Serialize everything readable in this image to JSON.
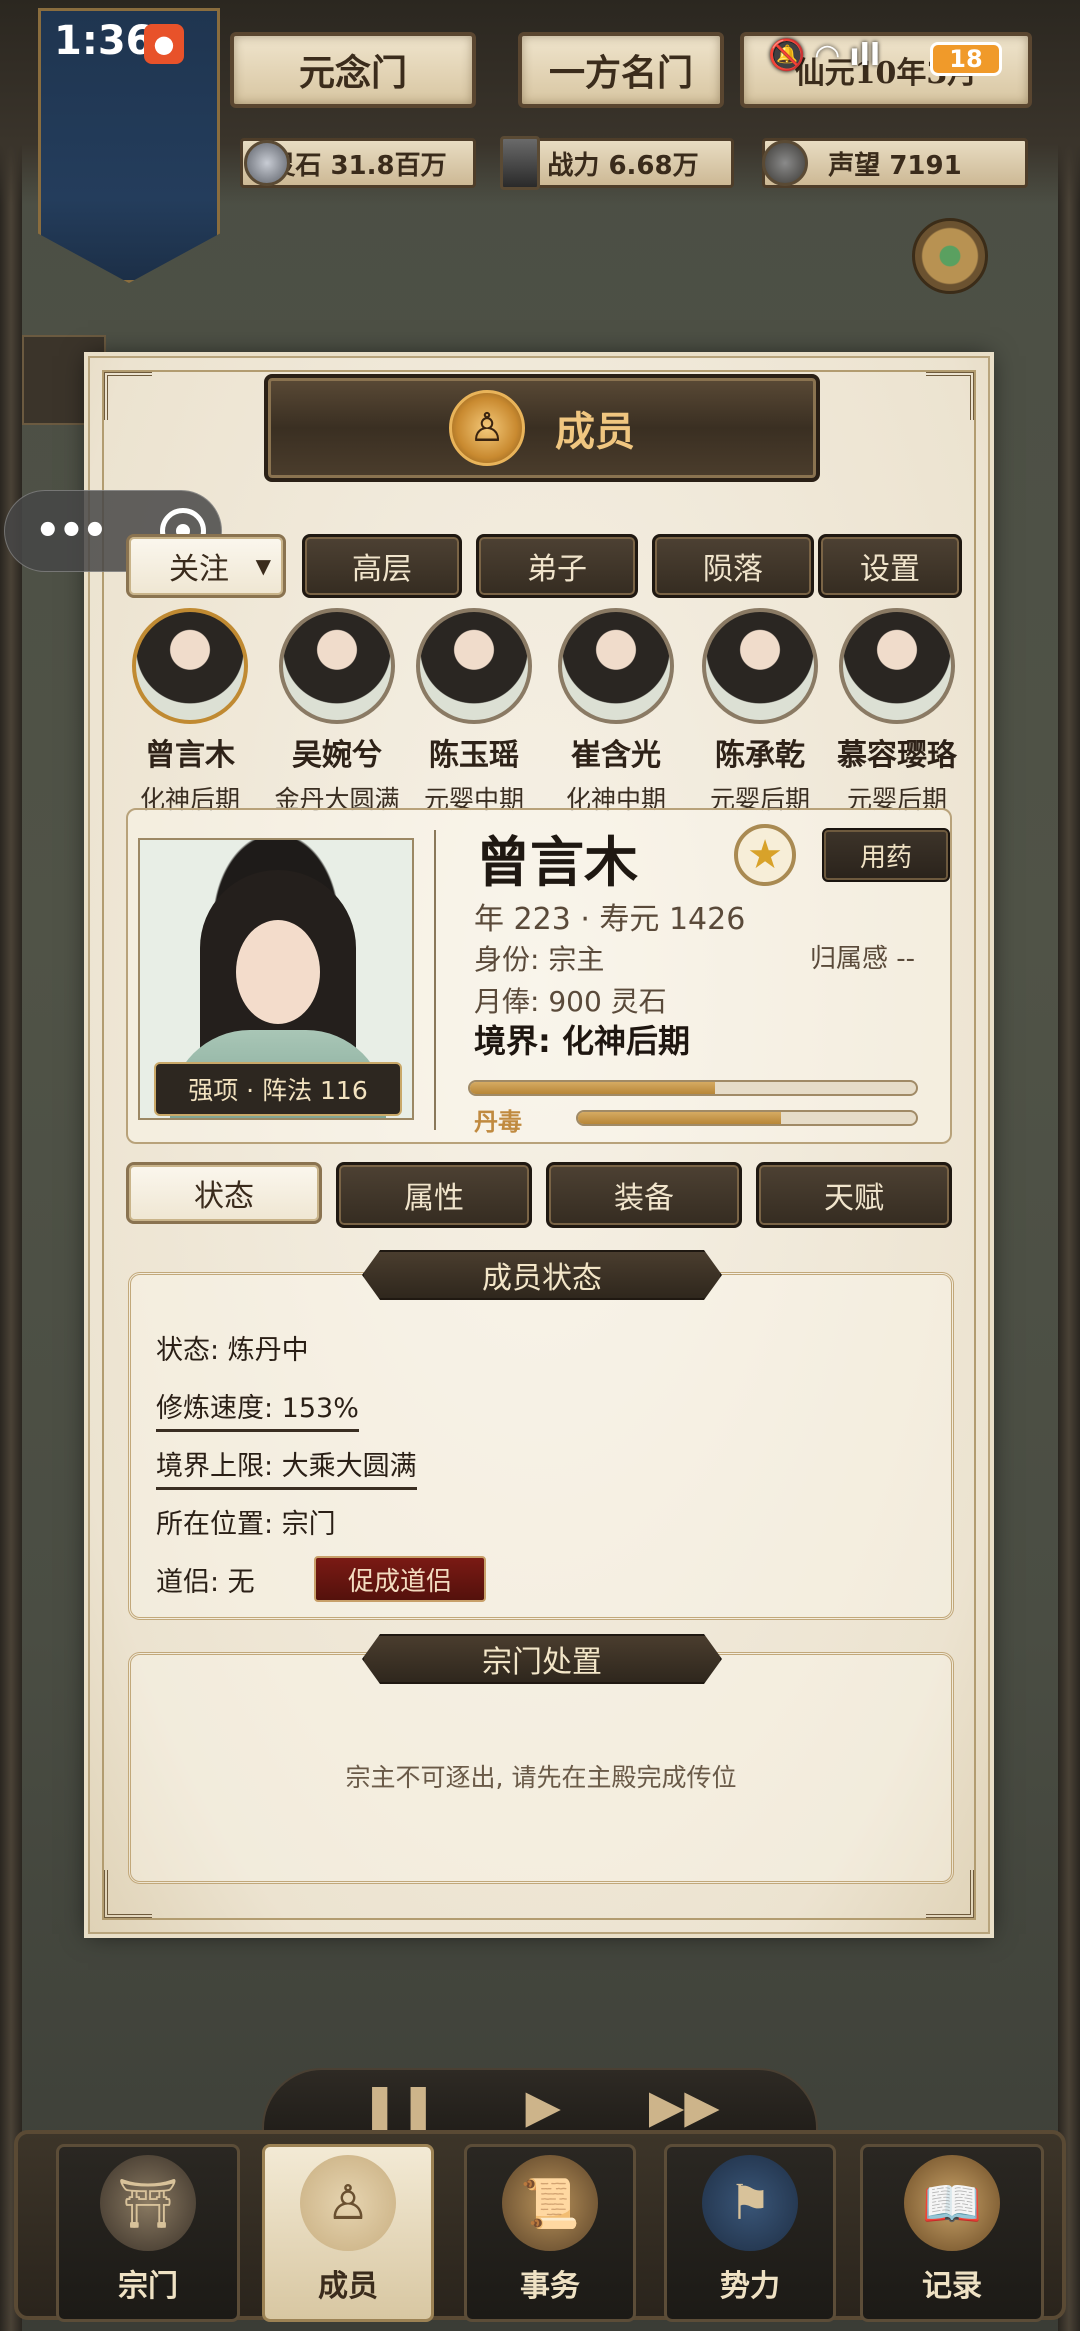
{
  "status_bar": {
    "time": "1:36",
    "battery": "18"
  },
  "sect": {
    "name": "元念门",
    "rank": "一方名门",
    "tag": "仙元10年3月"
  },
  "resources": {
    "spirit_stone": "灵石 31.8百万",
    "combat_power": "战力 6.68万",
    "prestige": "声望 7191"
  },
  "panel": {
    "title": "成员",
    "filter_label": "关注",
    "tabs": [
      "高层",
      "弟子",
      "陨落",
      "设置"
    ]
  },
  "members": [
    {
      "name": "曾言木",
      "realm": "化神后期"
    },
    {
      "name": "吴婉兮",
      "realm": "金丹大圆满"
    },
    {
      "name": "陈玉瑶",
      "realm": "元婴中期"
    },
    {
      "name": "崔含光",
      "realm": "化神中期"
    },
    {
      "name": "陈承乾",
      "realm": "元婴后期"
    },
    {
      "name": "慕容璎珞",
      "realm": "元婴后期"
    }
  ],
  "detail": {
    "name": "曾言木",
    "strength": "强项 · 阵法 116",
    "medicine_button": "用药",
    "age_line": "年 223 · 寿元 1426",
    "identity": "身份: 宗主",
    "belonging": "归属感 --",
    "salary": "月俸: 900 灵石",
    "realm": "境界: 化神后期",
    "cultivation_progress": 0.55,
    "poison_label": "丹毒",
    "poison_progress": 0.6
  },
  "detail_tabs": [
    "状态",
    "属性",
    "装备",
    "天赋"
  ],
  "status_section": {
    "title": "成员状态",
    "state": "状态: 炼丹中",
    "speed": "修炼速度: 153%",
    "limit": "境界上限: 大乘大圆满",
    "location": "所在位置: 宗门",
    "partner": "道侣: 无",
    "promote_button": "促成道侣"
  },
  "dispose_section": {
    "title": "宗门处置",
    "message": "宗主不可逐出, 请先在主殿完成传位"
  },
  "bottom_nav": [
    "宗门",
    "成员",
    "事务",
    "势力",
    "记录"
  ],
  "colors": {
    "accent": "#c08a32",
    "panel_bg": "#efe6d2",
    "dark_button": "#3a2f22",
    "promote": "#7a1a14"
  }
}
